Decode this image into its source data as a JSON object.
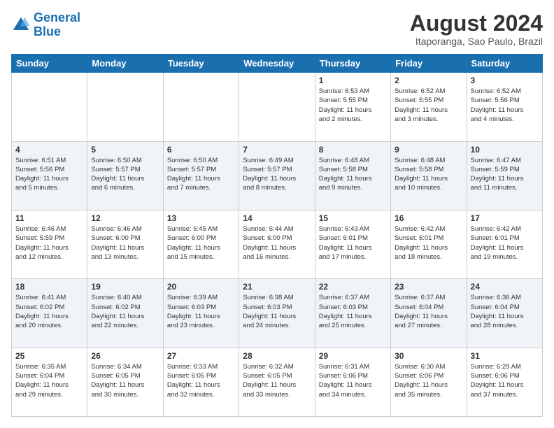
{
  "logo": {
    "line1": "General",
    "line2": "Blue"
  },
  "title": "August 2024",
  "location": "Itaporanga, Sao Paulo, Brazil",
  "days_of_week": [
    "Sunday",
    "Monday",
    "Tuesday",
    "Wednesday",
    "Thursday",
    "Friday",
    "Saturday"
  ],
  "weeks": [
    [
      {
        "day": "",
        "info": ""
      },
      {
        "day": "",
        "info": ""
      },
      {
        "day": "",
        "info": ""
      },
      {
        "day": "",
        "info": ""
      },
      {
        "day": "1",
        "info": "Sunrise: 6:53 AM\nSunset: 5:55 PM\nDaylight: 11 hours\nand 2 minutes."
      },
      {
        "day": "2",
        "info": "Sunrise: 6:52 AM\nSunset: 5:55 PM\nDaylight: 11 hours\nand 3 minutes."
      },
      {
        "day": "3",
        "info": "Sunrise: 6:52 AM\nSunset: 5:56 PM\nDaylight: 11 hours\nand 4 minutes."
      }
    ],
    [
      {
        "day": "4",
        "info": "Sunrise: 6:51 AM\nSunset: 5:56 PM\nDaylight: 11 hours\nand 5 minutes."
      },
      {
        "day": "5",
        "info": "Sunrise: 6:50 AM\nSunset: 5:57 PM\nDaylight: 11 hours\nand 6 minutes."
      },
      {
        "day": "6",
        "info": "Sunrise: 6:50 AM\nSunset: 5:57 PM\nDaylight: 11 hours\nand 7 minutes."
      },
      {
        "day": "7",
        "info": "Sunrise: 6:49 AM\nSunset: 5:57 PM\nDaylight: 11 hours\nand 8 minutes."
      },
      {
        "day": "8",
        "info": "Sunrise: 6:48 AM\nSunset: 5:58 PM\nDaylight: 11 hours\nand 9 minutes."
      },
      {
        "day": "9",
        "info": "Sunrise: 6:48 AM\nSunset: 5:58 PM\nDaylight: 11 hours\nand 10 minutes."
      },
      {
        "day": "10",
        "info": "Sunrise: 6:47 AM\nSunset: 5:59 PM\nDaylight: 11 hours\nand 11 minutes."
      }
    ],
    [
      {
        "day": "11",
        "info": "Sunrise: 6:46 AM\nSunset: 5:59 PM\nDaylight: 11 hours\nand 12 minutes."
      },
      {
        "day": "12",
        "info": "Sunrise: 6:46 AM\nSunset: 6:00 PM\nDaylight: 11 hours\nand 13 minutes."
      },
      {
        "day": "13",
        "info": "Sunrise: 6:45 AM\nSunset: 6:00 PM\nDaylight: 11 hours\nand 15 minutes."
      },
      {
        "day": "14",
        "info": "Sunrise: 6:44 AM\nSunset: 6:00 PM\nDaylight: 11 hours\nand 16 minutes."
      },
      {
        "day": "15",
        "info": "Sunrise: 6:43 AM\nSunset: 6:01 PM\nDaylight: 11 hours\nand 17 minutes."
      },
      {
        "day": "16",
        "info": "Sunrise: 6:42 AM\nSunset: 6:01 PM\nDaylight: 11 hours\nand 18 minutes."
      },
      {
        "day": "17",
        "info": "Sunrise: 6:42 AM\nSunset: 6:01 PM\nDaylight: 11 hours\nand 19 minutes."
      }
    ],
    [
      {
        "day": "18",
        "info": "Sunrise: 6:41 AM\nSunset: 6:02 PM\nDaylight: 11 hours\nand 20 minutes."
      },
      {
        "day": "19",
        "info": "Sunrise: 6:40 AM\nSunset: 6:02 PM\nDaylight: 11 hours\nand 22 minutes."
      },
      {
        "day": "20",
        "info": "Sunrise: 6:39 AM\nSunset: 6:03 PM\nDaylight: 11 hours\nand 23 minutes."
      },
      {
        "day": "21",
        "info": "Sunrise: 6:38 AM\nSunset: 6:03 PM\nDaylight: 11 hours\nand 24 minutes."
      },
      {
        "day": "22",
        "info": "Sunrise: 6:37 AM\nSunset: 6:03 PM\nDaylight: 11 hours\nand 25 minutes."
      },
      {
        "day": "23",
        "info": "Sunrise: 6:37 AM\nSunset: 6:04 PM\nDaylight: 11 hours\nand 27 minutes."
      },
      {
        "day": "24",
        "info": "Sunrise: 6:36 AM\nSunset: 6:04 PM\nDaylight: 11 hours\nand 28 minutes."
      }
    ],
    [
      {
        "day": "25",
        "info": "Sunrise: 6:35 AM\nSunset: 6:04 PM\nDaylight: 11 hours\nand 29 minutes."
      },
      {
        "day": "26",
        "info": "Sunrise: 6:34 AM\nSunset: 6:05 PM\nDaylight: 11 hours\nand 30 minutes."
      },
      {
        "day": "27",
        "info": "Sunrise: 6:33 AM\nSunset: 6:05 PM\nDaylight: 11 hours\nand 32 minutes."
      },
      {
        "day": "28",
        "info": "Sunrise: 6:32 AM\nSunset: 6:05 PM\nDaylight: 11 hours\nand 33 minutes."
      },
      {
        "day": "29",
        "info": "Sunrise: 6:31 AM\nSunset: 6:06 PM\nDaylight: 11 hours\nand 34 minutes."
      },
      {
        "day": "30",
        "info": "Sunrise: 6:30 AM\nSunset: 6:06 PM\nDaylight: 11 hours\nand 35 minutes."
      },
      {
        "day": "31",
        "info": "Sunrise: 6:29 AM\nSunset: 6:06 PM\nDaylight: 11 hours\nand 37 minutes."
      }
    ]
  ]
}
